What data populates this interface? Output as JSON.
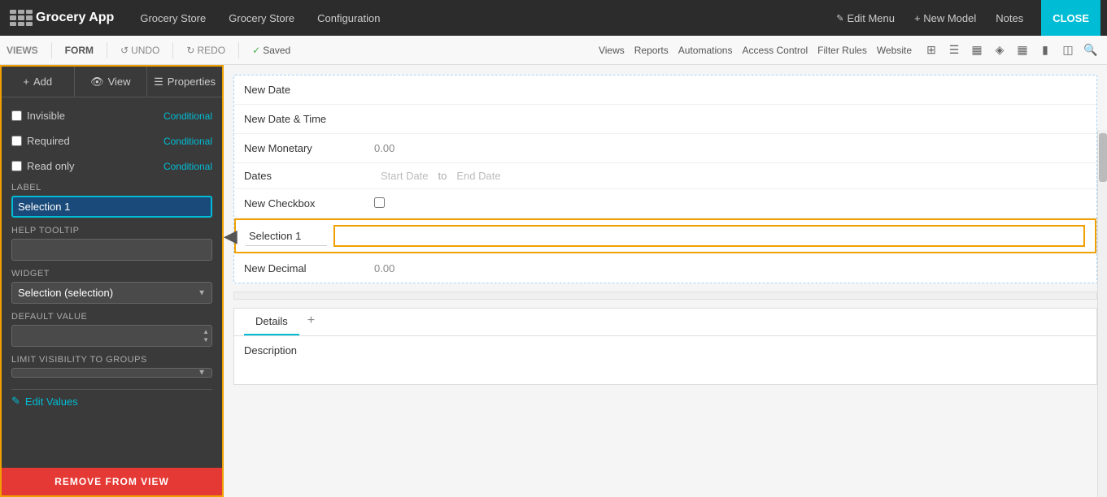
{
  "topnav": {
    "app_name": "Grocery App",
    "nav_links": [
      "Grocery Store",
      "Grocery Store",
      "Configuration"
    ],
    "edit_menu": "Edit Menu",
    "new_model": "+ New Model",
    "notes": "Notes",
    "close": "CLOSE"
  },
  "secondbar": {
    "views": "VIEWS",
    "form": "FORM",
    "undo": "UNDO",
    "redo": "REDO",
    "saved": "Saved",
    "right_links": [
      "Views",
      "Reports",
      "Automations",
      "Access Control",
      "Filter Rules",
      "Website"
    ]
  },
  "sidebar": {
    "add_label": "Add",
    "view_label": "View",
    "properties_label": "Properties",
    "invisible_label": "Invisible",
    "required_label": "Required",
    "read_only_label": "Read only",
    "conditional": "Conditional",
    "label_section": "Label",
    "label_value": "Selection 1",
    "help_tooltip": "Help Tooltip",
    "widget_label": "Widget",
    "widget_value": "Selection (selection)",
    "default_value_label": "Default value",
    "limit_visibility_label": "Limit visibility to groups",
    "edit_values_label": "Edit Values",
    "remove_btn": "REMOVE FROM VIEW"
  },
  "form": {
    "fields": [
      {
        "name": "New Date",
        "value": ""
      },
      {
        "name": "New Date & Time",
        "value": ""
      },
      {
        "name": "New Monetary",
        "value": "0.00"
      },
      {
        "name": "Dates",
        "value": ""
      },
      {
        "name": "New Checkbox",
        "value": "checkbox"
      },
      {
        "name": "New Decimal",
        "value": "0.00"
      }
    ],
    "selection_label": "Selection 1",
    "selection_value": "",
    "start_date": "Start Date",
    "to": "to",
    "end_date": "End Date"
  },
  "tabs": {
    "details": "Details",
    "add_icon": "+"
  },
  "description": {
    "label": "Description"
  }
}
